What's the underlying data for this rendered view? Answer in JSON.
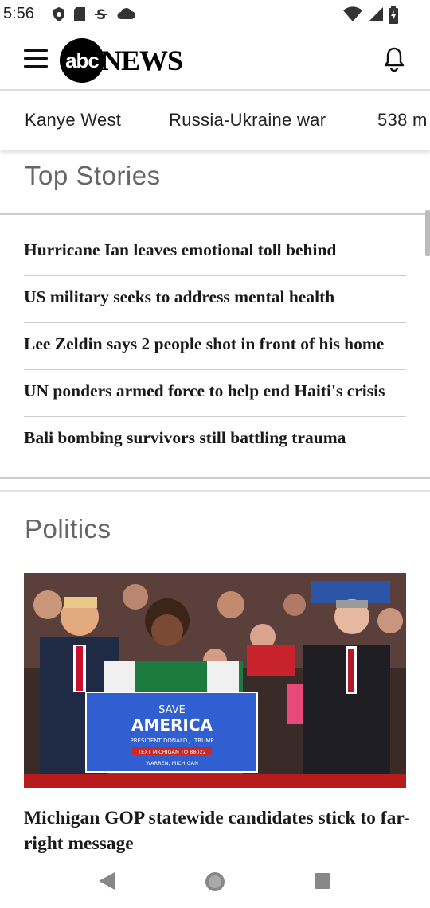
{
  "status_bar": {
    "time": "5:56",
    "left_icons": [
      "shield-icon",
      "sim-card-icon",
      "strikethrough-s-icon",
      "cloud-icon"
    ],
    "right_icons": [
      "wifi-icon",
      "signal-icon",
      "battery-icon"
    ]
  },
  "app_bar": {
    "logo_abc": "abc",
    "logo_news": "NEWS",
    "icons": {
      "menu": "hamburger-menu-icon",
      "notifications": "bell-icon"
    }
  },
  "topics": [
    "Kanye West",
    "Russia-Ukraine war",
    "538 m"
  ],
  "top_stories": {
    "title": "Top Stories",
    "items": [
      "Hurricane Ian leaves emotional toll behind",
      "US military seeks to address mental health",
      "Lee Zeldin says 2 people shot in front of his home",
      "UN ponders armed force to help end Haiti's crisis",
      "Bali bombing survivors still battling trauma"
    ]
  },
  "politics": {
    "title": "Politics",
    "photo": {
      "sign_line1": "SAVE",
      "sign_line2": "AMERICA",
      "sign_line3": "PRESIDENT DONALD J. TRUMP",
      "sign_line4": "TEXT MICHIGAN TO 88022",
      "sign_line5": "WARREN, MICHIGAN"
    },
    "headline": "Michigan GOP statewide candidates stick to far-right message"
  },
  "nav_bar": {
    "icons": [
      "back-triangle-icon",
      "home-circle-icon",
      "recents-square-icon"
    ]
  },
  "colors": {
    "accent": "#000000",
    "divider": "#cccccc",
    "section_title": "#666666"
  }
}
